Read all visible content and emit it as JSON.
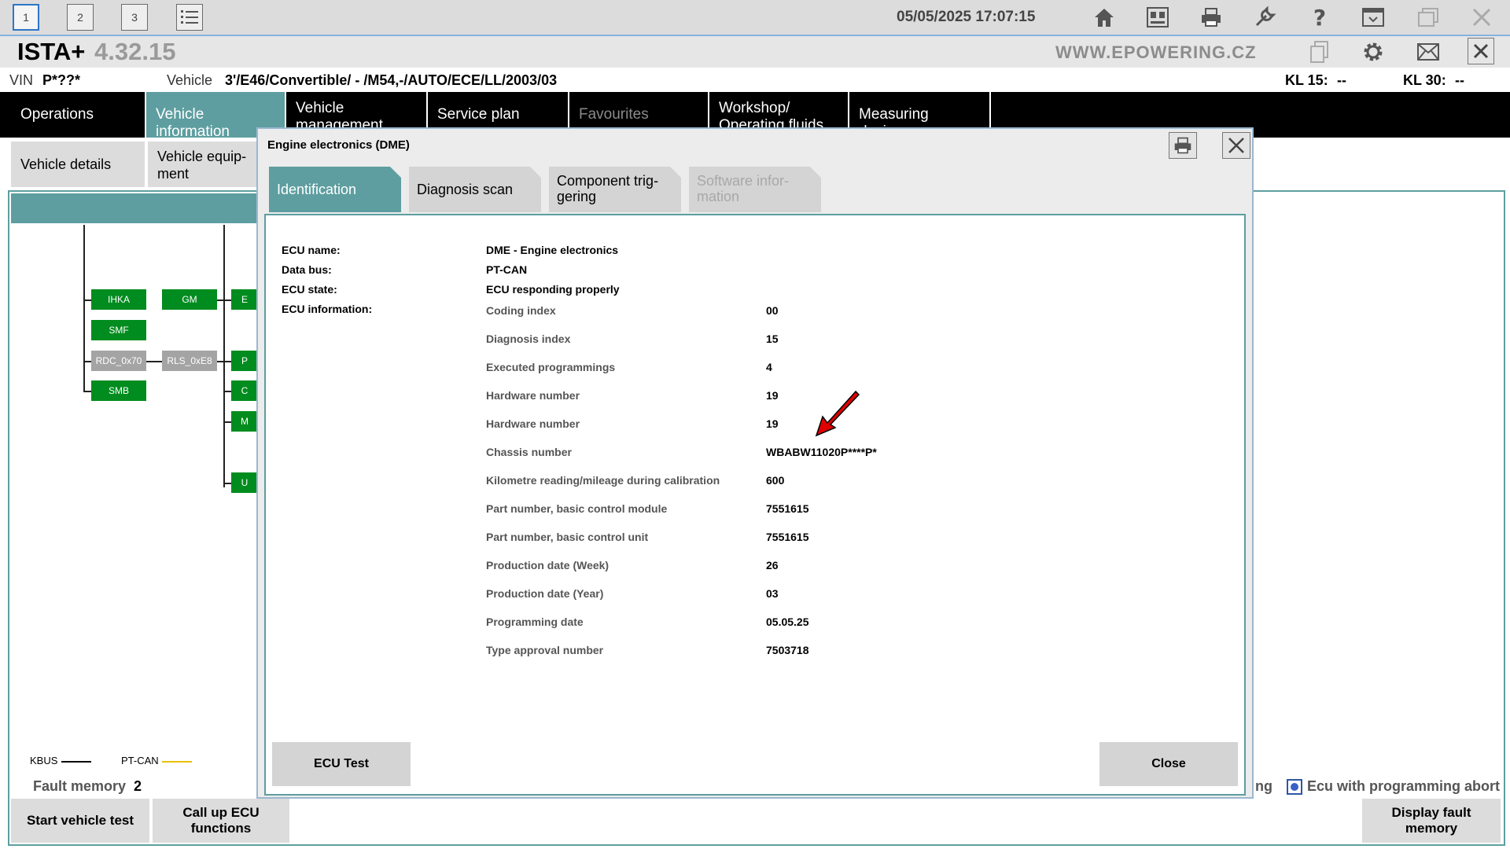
{
  "toolbar": {
    "window_buttons": [
      "1",
      "2",
      "3"
    ],
    "datetime": "05/05/2025 17:07:15"
  },
  "header": {
    "app_name": "ISTA+",
    "version": "4.32.15",
    "website": "WWW.EPOWERING.CZ"
  },
  "vehicle_line": {
    "vin_label": "VIN",
    "vin_value": "P*??*",
    "vehicle_label": "Vehicle",
    "vehicle_value": "3'/E46/Convertible/ - /M54,-/AUTO/ECE/LL/2003/03",
    "kl15_label": "KL 15:",
    "kl15_value": "--",
    "kl30_label": "KL 30:",
    "kl30_value": "--"
  },
  "main_nav": [
    {
      "label": "Operations",
      "state": "normal"
    },
    {
      "label": "Vehicle information",
      "state": "active"
    },
    {
      "label": "Vehicle management",
      "state": "normal"
    },
    {
      "label": "Service plan",
      "state": "normal"
    },
    {
      "label": "Favourites",
      "state": "disabled"
    },
    {
      "label": "Workshop/ Operating fluids",
      "state": "normal"
    },
    {
      "label": "Measuring devices",
      "state": "normal"
    }
  ],
  "sub_nav": [
    {
      "label": "Vehicle details"
    },
    {
      "label": "Vehicle equip- ment"
    }
  ],
  "ecu_tree": {
    "col1": [
      "IHKA",
      "SMF",
      "RDC_0x70",
      "SMB"
    ],
    "col2": [
      "GM",
      "RLS_0xE8"
    ],
    "col3_partial": [
      "E",
      "P",
      "C",
      "M",
      "U"
    ]
  },
  "legend": {
    "kbus": "KBUS",
    "ptcan": "PT-CAN",
    "kbus_color": "#000000",
    "ptcan_color": "#e8c000"
  },
  "fault_memory": {
    "label": "Fault memory",
    "count": "2"
  },
  "background_bottom": {
    "start_vehicle_test": "Start vehicle test",
    "call_up_ecu_functions": "Call up ECU functions",
    "display_fault_memory": "Display fault memory",
    "ecu_programming_abort": "Ecu with programming abort",
    "partial_text": "ng"
  },
  "modal": {
    "title": "Engine electronics (DME)",
    "tabs": [
      {
        "label": "Identification",
        "state": "active"
      },
      {
        "label": "Diagnosis scan",
        "state": "normal"
      },
      {
        "label": "Component trig- gering",
        "state": "normal"
      },
      {
        "label": "Software infor- mation",
        "state": "disabled"
      }
    ],
    "ecu_name_label": "ECU name:",
    "ecu_name_value": "DME - Engine electronics",
    "data_bus_label": "Data bus:",
    "data_bus_value": "PT-CAN",
    "ecu_state_label": "ECU state:",
    "ecu_state_value": "ECU responding properly",
    "ecu_info_label": "ECU information:",
    "ecu_info": [
      {
        "label": "Coding index",
        "value": "00"
      },
      {
        "label": "Diagnosis index",
        "value": "15"
      },
      {
        "label": "Executed programmings",
        "value": "4"
      },
      {
        "label": "Hardware number",
        "value": "19"
      },
      {
        "label": "Hardware number",
        "value": "19"
      },
      {
        "label": "Chassis number",
        "value": "WBABW11020P****P*"
      },
      {
        "label": "Kilometre reading/mileage during calibration",
        "value": "600"
      },
      {
        "label": "Part number, basic control module",
        "value": "7551615"
      },
      {
        "label": "Part number, basic control unit",
        "value": "7551615"
      },
      {
        "label": "Production date (Week)",
        "value": "26"
      },
      {
        "label": "Production date (Year)",
        "value": "03"
      },
      {
        "label": "Programming date",
        "value": "05.05.25"
      },
      {
        "label": "Type approval number",
        "value": "7503718"
      }
    ],
    "ecu_test_button": "ECU Test",
    "close_button": "Close",
    "arrow_color": "#e00000"
  }
}
